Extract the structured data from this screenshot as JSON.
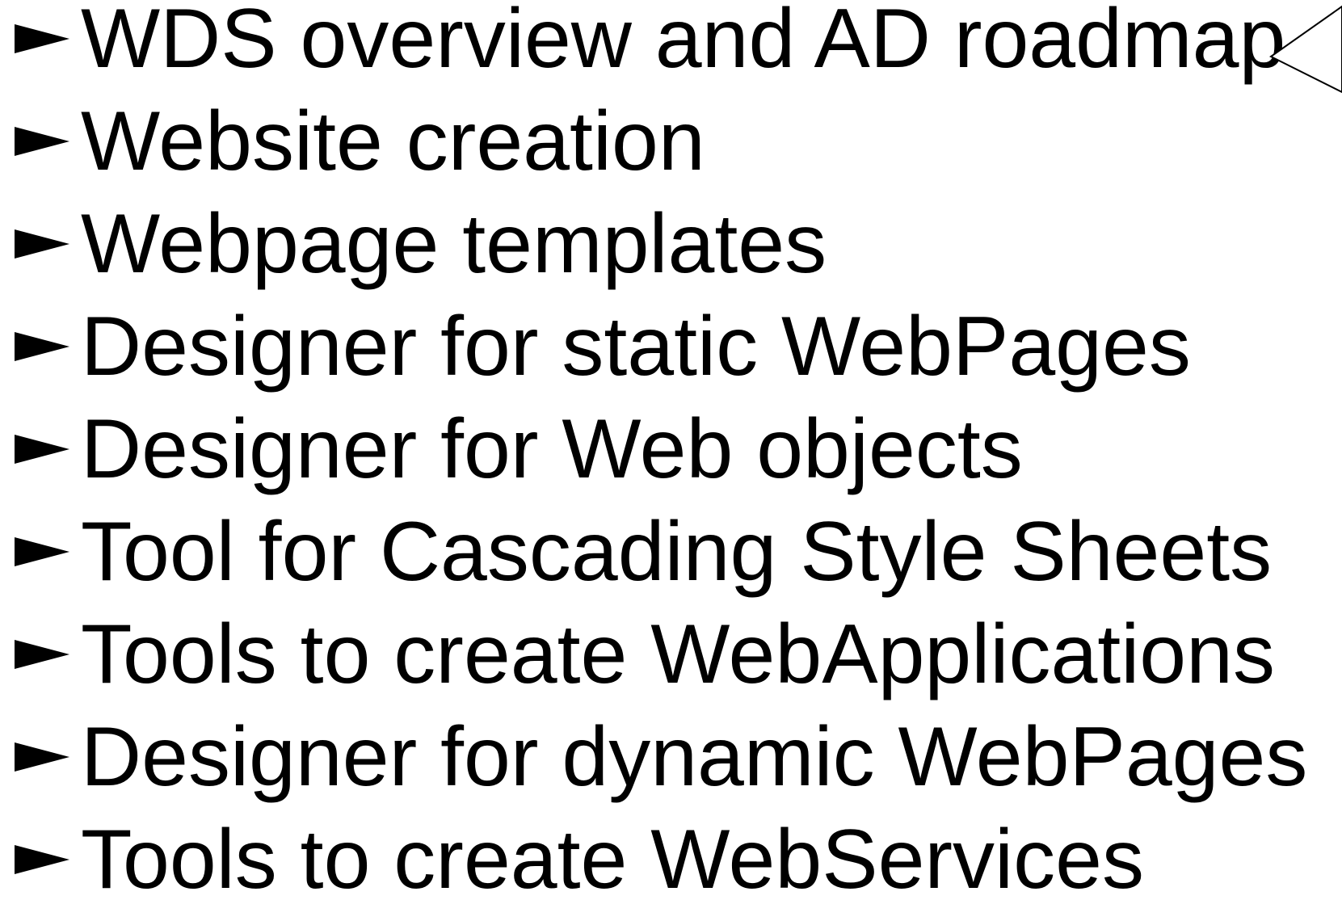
{
  "slide": {
    "items": [
      {
        "text": "WDS overview and AD roadmap"
      },
      {
        "text": "Website creation"
      },
      {
        "text": "Webpage templates"
      },
      {
        "text": "Designer for static WebPages"
      },
      {
        "text": "Designer for Web objects"
      },
      {
        "text": "Tool for Cascading Style Sheets"
      },
      {
        "text": "Tools to create WebApplications"
      },
      {
        "text": "Designer for dynamic WebPages"
      },
      {
        "text": "Tools to create WebServices"
      }
    ],
    "bullet_icon": "right-pointing-triangle-icon",
    "callout_icon": "callout-pointer-icon"
  }
}
